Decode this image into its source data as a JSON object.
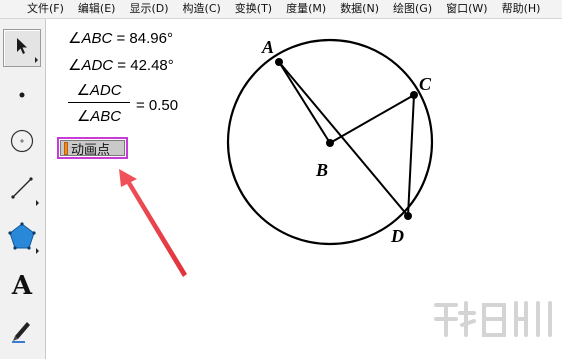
{
  "menu": {
    "items": [
      {
        "label": "文件(F)"
      },
      {
        "label": "编辑(E)"
      },
      {
        "label": "显示(D)"
      },
      {
        "label": "构造(C)"
      },
      {
        "label": "变换(T)"
      },
      {
        "label": "度量(M)"
      },
      {
        "label": "数据(N)"
      },
      {
        "label": "绘图(G)"
      },
      {
        "label": "窗口(W)"
      },
      {
        "label": "帮助(H)"
      }
    ]
  },
  "toolbox": {
    "tools": [
      {
        "icon": "arrow-select-icon",
        "selected": true
      },
      {
        "icon": "point-icon"
      },
      {
        "icon": "compass-circle-icon"
      },
      {
        "icon": "straightedge-line-icon"
      },
      {
        "icon": "polygon-icon"
      },
      {
        "icon": "text-tool-icon",
        "glyph": "A"
      },
      {
        "icon": "marker-pen-icon"
      }
    ]
  },
  "measurements": {
    "angle_abc": {
      "symbol": "∠",
      "name": "ABC",
      "eq": " = ",
      "value": "84.96°"
    },
    "angle_adc": {
      "symbol": "∠",
      "name": "ADC",
      "eq": " = ",
      "value": "42.48°"
    },
    "ratio": {
      "numerator": "∠ADC",
      "denominator": "∠ABC",
      "result": "= 0.50"
    }
  },
  "animate_button": {
    "label": "动画点"
  },
  "figure": {
    "points": {
      "A": "A",
      "B": "B",
      "C": "C",
      "D": "D"
    },
    "colors": {
      "stroke": "#000000",
      "point": "#000000",
      "arrow": "#e8414a",
      "selection": "#c83bd8"
    }
  }
}
